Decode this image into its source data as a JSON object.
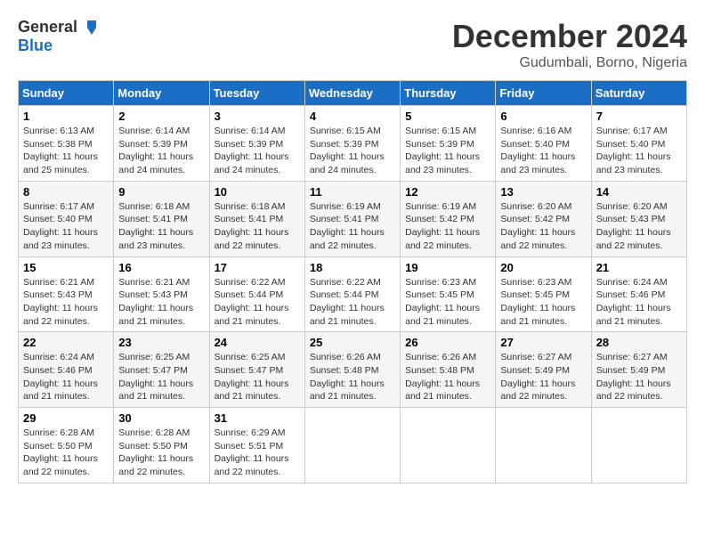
{
  "header": {
    "logo_general": "General",
    "logo_blue": "Blue",
    "month_title": "December 2024",
    "location": "Gudumbali, Borno, Nigeria"
  },
  "days_of_week": [
    "Sunday",
    "Monday",
    "Tuesday",
    "Wednesday",
    "Thursday",
    "Friday",
    "Saturday"
  ],
  "weeks": [
    [
      {
        "day": "1",
        "sunrise": "Sunrise: 6:13 AM",
        "sunset": "Sunset: 5:38 PM",
        "daylight": "Daylight: 11 hours and 25 minutes."
      },
      {
        "day": "2",
        "sunrise": "Sunrise: 6:14 AM",
        "sunset": "Sunset: 5:39 PM",
        "daylight": "Daylight: 11 hours and 24 minutes."
      },
      {
        "day": "3",
        "sunrise": "Sunrise: 6:14 AM",
        "sunset": "Sunset: 5:39 PM",
        "daylight": "Daylight: 11 hours and 24 minutes."
      },
      {
        "day": "4",
        "sunrise": "Sunrise: 6:15 AM",
        "sunset": "Sunset: 5:39 PM",
        "daylight": "Daylight: 11 hours and 24 minutes."
      },
      {
        "day": "5",
        "sunrise": "Sunrise: 6:15 AM",
        "sunset": "Sunset: 5:39 PM",
        "daylight": "Daylight: 11 hours and 23 minutes."
      },
      {
        "day": "6",
        "sunrise": "Sunrise: 6:16 AM",
        "sunset": "Sunset: 5:40 PM",
        "daylight": "Daylight: 11 hours and 23 minutes."
      },
      {
        "day": "7",
        "sunrise": "Sunrise: 6:17 AM",
        "sunset": "Sunset: 5:40 PM",
        "daylight": "Daylight: 11 hours and 23 minutes."
      }
    ],
    [
      {
        "day": "8",
        "sunrise": "Sunrise: 6:17 AM",
        "sunset": "Sunset: 5:40 PM",
        "daylight": "Daylight: 11 hours and 23 minutes."
      },
      {
        "day": "9",
        "sunrise": "Sunrise: 6:18 AM",
        "sunset": "Sunset: 5:41 PM",
        "daylight": "Daylight: 11 hours and 23 minutes."
      },
      {
        "day": "10",
        "sunrise": "Sunrise: 6:18 AM",
        "sunset": "Sunset: 5:41 PM",
        "daylight": "Daylight: 11 hours and 22 minutes."
      },
      {
        "day": "11",
        "sunrise": "Sunrise: 6:19 AM",
        "sunset": "Sunset: 5:41 PM",
        "daylight": "Daylight: 11 hours and 22 minutes."
      },
      {
        "day": "12",
        "sunrise": "Sunrise: 6:19 AM",
        "sunset": "Sunset: 5:42 PM",
        "daylight": "Daylight: 11 hours and 22 minutes."
      },
      {
        "day": "13",
        "sunrise": "Sunrise: 6:20 AM",
        "sunset": "Sunset: 5:42 PM",
        "daylight": "Daylight: 11 hours and 22 minutes."
      },
      {
        "day": "14",
        "sunrise": "Sunrise: 6:20 AM",
        "sunset": "Sunset: 5:43 PM",
        "daylight": "Daylight: 11 hours and 22 minutes."
      }
    ],
    [
      {
        "day": "15",
        "sunrise": "Sunrise: 6:21 AM",
        "sunset": "Sunset: 5:43 PM",
        "daylight": "Daylight: 11 hours and 22 minutes."
      },
      {
        "day": "16",
        "sunrise": "Sunrise: 6:21 AM",
        "sunset": "Sunset: 5:43 PM",
        "daylight": "Daylight: 11 hours and 21 minutes."
      },
      {
        "day": "17",
        "sunrise": "Sunrise: 6:22 AM",
        "sunset": "Sunset: 5:44 PM",
        "daylight": "Daylight: 11 hours and 21 minutes."
      },
      {
        "day": "18",
        "sunrise": "Sunrise: 6:22 AM",
        "sunset": "Sunset: 5:44 PM",
        "daylight": "Daylight: 11 hours and 21 minutes."
      },
      {
        "day": "19",
        "sunrise": "Sunrise: 6:23 AM",
        "sunset": "Sunset: 5:45 PM",
        "daylight": "Daylight: 11 hours and 21 minutes."
      },
      {
        "day": "20",
        "sunrise": "Sunrise: 6:23 AM",
        "sunset": "Sunset: 5:45 PM",
        "daylight": "Daylight: 11 hours and 21 minutes."
      },
      {
        "day": "21",
        "sunrise": "Sunrise: 6:24 AM",
        "sunset": "Sunset: 5:46 PM",
        "daylight": "Daylight: 11 hours and 21 minutes."
      }
    ],
    [
      {
        "day": "22",
        "sunrise": "Sunrise: 6:24 AM",
        "sunset": "Sunset: 5:46 PM",
        "daylight": "Daylight: 11 hours and 21 minutes."
      },
      {
        "day": "23",
        "sunrise": "Sunrise: 6:25 AM",
        "sunset": "Sunset: 5:47 PM",
        "daylight": "Daylight: 11 hours and 21 minutes."
      },
      {
        "day": "24",
        "sunrise": "Sunrise: 6:25 AM",
        "sunset": "Sunset: 5:47 PM",
        "daylight": "Daylight: 11 hours and 21 minutes."
      },
      {
        "day": "25",
        "sunrise": "Sunrise: 6:26 AM",
        "sunset": "Sunset: 5:48 PM",
        "daylight": "Daylight: 11 hours and 21 minutes."
      },
      {
        "day": "26",
        "sunrise": "Sunrise: 6:26 AM",
        "sunset": "Sunset: 5:48 PM",
        "daylight": "Daylight: 11 hours and 21 minutes."
      },
      {
        "day": "27",
        "sunrise": "Sunrise: 6:27 AM",
        "sunset": "Sunset: 5:49 PM",
        "daylight": "Daylight: 11 hours and 22 minutes."
      },
      {
        "day": "28",
        "sunrise": "Sunrise: 6:27 AM",
        "sunset": "Sunset: 5:49 PM",
        "daylight": "Daylight: 11 hours and 22 minutes."
      }
    ],
    [
      {
        "day": "29",
        "sunrise": "Sunrise: 6:28 AM",
        "sunset": "Sunset: 5:50 PM",
        "daylight": "Daylight: 11 hours and 22 minutes."
      },
      {
        "day": "30",
        "sunrise": "Sunrise: 6:28 AM",
        "sunset": "Sunset: 5:50 PM",
        "daylight": "Daylight: 11 hours and 22 minutes."
      },
      {
        "day": "31",
        "sunrise": "Sunrise: 6:29 AM",
        "sunset": "Sunset: 5:51 PM",
        "daylight": "Daylight: 11 hours and 22 minutes."
      },
      null,
      null,
      null,
      null
    ]
  ]
}
